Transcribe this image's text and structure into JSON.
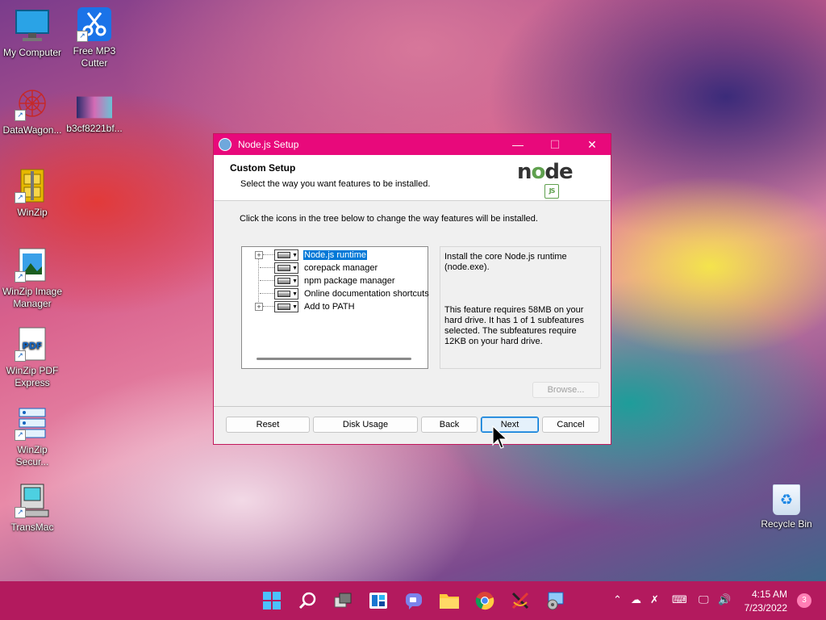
{
  "desktop": {
    "icons": [
      {
        "label": "My Computer"
      },
      {
        "label": "Free MP3 Cutter"
      },
      {
        "label": "DataWagon..."
      },
      {
        "label": "b3cf8221bf..."
      },
      {
        "label": "WinZip"
      },
      {
        "label": "WinZip Image Manager"
      },
      {
        "label": "WinZip PDF Express"
      },
      {
        "label": "WinZip Secur..."
      },
      {
        "label": "TransMac"
      },
      {
        "label": "Recycle Bin"
      }
    ]
  },
  "dialog": {
    "window_title": "Node.js Setup",
    "header_title": "Custom Setup",
    "header_subtitle": "Select the way you want features to be installed.",
    "logo_text": "node",
    "logo_badge": "JS",
    "instruction": "Click the icons in the tree below to change the way features will be installed.",
    "tree": [
      {
        "label": "Node.js runtime",
        "selected": true,
        "expandable": true
      },
      {
        "label": "corepack manager",
        "selected": false,
        "expandable": false
      },
      {
        "label": "npm package manager",
        "selected": false,
        "expandable": false
      },
      {
        "label": "Online documentation shortcuts",
        "selected": false,
        "expandable": false
      },
      {
        "label": "Add to PATH",
        "selected": false,
        "expandable": true
      }
    ],
    "description_1": "Install the core Node.js runtime (node.exe).",
    "description_2": "This feature requires 58MB on your hard drive. It has 1 of 1 subfeatures selected. The subfeatures require 12KB on your hard drive.",
    "buttons": {
      "browse": "Browse...",
      "reset": "Reset",
      "disk_usage": "Disk Usage",
      "back": "Back",
      "next": "Next",
      "cancel": "Cancel"
    },
    "controls": {
      "minimize": "—",
      "maximize": "☐",
      "close": "✕"
    }
  },
  "taskbar": {
    "time": "4:15 AM",
    "date": "7/23/2022",
    "notification_count": "3",
    "accent": "#b31a5e"
  }
}
